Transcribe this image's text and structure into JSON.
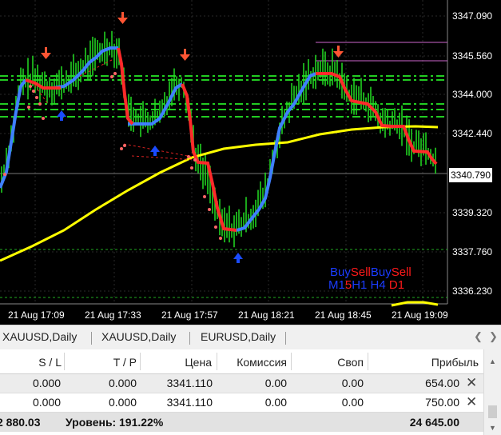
{
  "chart": {
    "price_axis": [
      "3347.090",
      "3345.560",
      "3344.000",
      "3342.440",
      "3340.790",
      "3339.320",
      "3337.760",
      "3336.230"
    ],
    "current_price": "3340.790",
    "time_axis": [
      "21 Aug 17:09",
      "21 Aug 17:33",
      "21 Aug 17:57",
      "21 Aug 18:21",
      "21 Aug 18:45",
      "21 Aug 19:09"
    ],
    "indicator_line1": [
      "Buy",
      "Sell",
      "Buy",
      "Sell"
    ],
    "indicator_line2": [
      "M1",
      "5",
      "H1",
      "H4",
      "D1"
    ],
    "colors": {
      "background": "#000000",
      "candles": "#22dd22",
      "trend_up": "#3f7fff",
      "trend_down": "#ff2a2a",
      "moving_average": "#ffff00",
      "levels": "#22cc22",
      "arrow_up": "#1a4bff",
      "arrow_down": "#ff5533"
    }
  },
  "tabs": [
    "XAUUSD,Daily",
    "XAUUSD,Daily",
    "EURUSD,Daily"
  ],
  "table": {
    "headers": [
      "S / L",
      "T / P",
      "Цена",
      "Комиссия",
      "Своп",
      "Прибыль"
    ],
    "rows": [
      [
        "0.000",
        "0.000",
        "3341.110",
        "0.00",
        "0.00",
        "654.00"
      ],
      [
        "0.000",
        "0.000",
        "3341.110",
        "0.00",
        "0.00",
        "750.00"
      ]
    ],
    "summary": {
      "balance_fragment": "2 880.03",
      "level_label": "Уровень:",
      "level_value": "191.22%",
      "total_profit": "24 645.00"
    }
  }
}
